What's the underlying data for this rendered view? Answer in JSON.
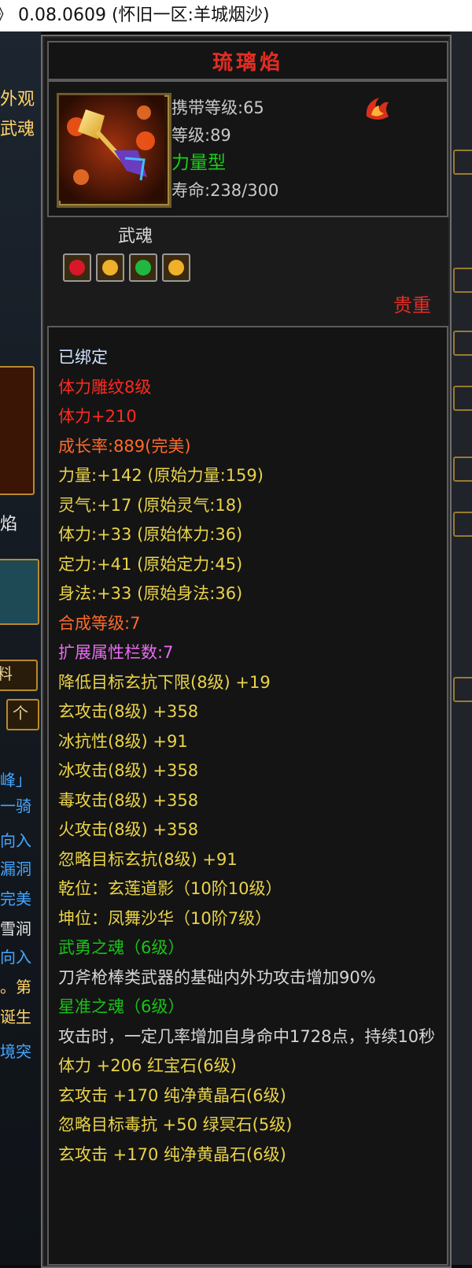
{
  "window": {
    "title": "》 0.08.0609 (怀旧一区:羊城烟沙)"
  },
  "left_strip": {
    "t1": "外观",
    "t2": "武魂",
    "t3": "焰",
    "t4": "料",
    "t5": "个",
    "t6": "峰」",
    "t7": "一骑",
    "t8": "向入",
    "t9": "漏洞",
    "t10": "完美",
    "t11": "雪涧",
    "t12": "向入",
    "t13": "。第",
    "t14": "诞生",
    "t15": "境突"
  },
  "item": {
    "name": "琉璃焰",
    "carry_level": "携带等级:65",
    "level": "等级:89",
    "type": "力量型",
    "lifespan": "寿命:238/300",
    "soul_label": "武魂",
    "rarity": "贵重",
    "gem_icons": [
      "red-gem-icon",
      "yellow-gem-icon",
      "green-gem-icon",
      "yellow-gem-icon"
    ]
  },
  "properties": [
    {
      "text": "已绑定",
      "color": "blue"
    },
    {
      "text": "体力雕纹8级",
      "color": "red"
    },
    {
      "text": "体力+210",
      "color": "red"
    },
    {
      "text": "成长率:889(完美)",
      "color": "orange"
    },
    {
      "text": "力量:+142 (原始力量:159)",
      "color": "yellow"
    },
    {
      "text": "灵气:+17 (原始灵气:18)",
      "color": "yellow"
    },
    {
      "text": "体力:+33 (原始体力:36)",
      "color": "yellow"
    },
    {
      "text": "定力:+41 (原始定力:45)",
      "color": "yellow"
    },
    {
      "text": "身法:+33 (原始身法:36)",
      "color": "yellow"
    },
    {
      "text": "合成等级:7",
      "color": "orange"
    },
    {
      "text": "扩展属性栏数:7",
      "color": "pink"
    },
    {
      "text": "降低目标玄抗下限(8级) +19",
      "color": "yellow"
    },
    {
      "text": "玄攻击(8级) +358",
      "color": "yellow"
    },
    {
      "text": "冰抗性(8级) +91",
      "color": "yellow"
    },
    {
      "text": "冰攻击(8级) +358",
      "color": "yellow"
    },
    {
      "text": "毒攻击(8级) +358",
      "color": "yellow"
    },
    {
      "text": "火攻击(8级) +358",
      "color": "yellow"
    },
    {
      "text": "忽略目标玄抗(8级) +91",
      "color": "yellow"
    },
    {
      "text": "乾位：玄莲道影（10阶10级）",
      "color": "yellow"
    },
    {
      "text": "坤位：凤舞沙华（10阶7级）",
      "color": "yellow"
    },
    {
      "text": "武勇之魂（6级）",
      "color": "green"
    },
    {
      "text": "刀斧枪棒类武器的基础内外功攻击增加90%",
      "color": "white",
      "wrap": true
    },
    {
      "text": "星准之魂（6级）",
      "color": "green"
    },
    {
      "text": "攻击时，一定几率增加自身命中1728点，持续10秒",
      "color": "white",
      "wrap": true
    },
    {
      "text": "体力 +206 红宝石(6级)",
      "color": "yellow"
    },
    {
      "text": "玄攻击 +170 纯净黄晶石(6级)",
      "color": "yellow"
    },
    {
      "text": "忽略目标毒抗 +50 绿冥石(5级)",
      "color": "yellow"
    },
    {
      "text": "玄攻击 +170 纯净黄晶石(6级)",
      "color": "yellow"
    }
  ]
}
